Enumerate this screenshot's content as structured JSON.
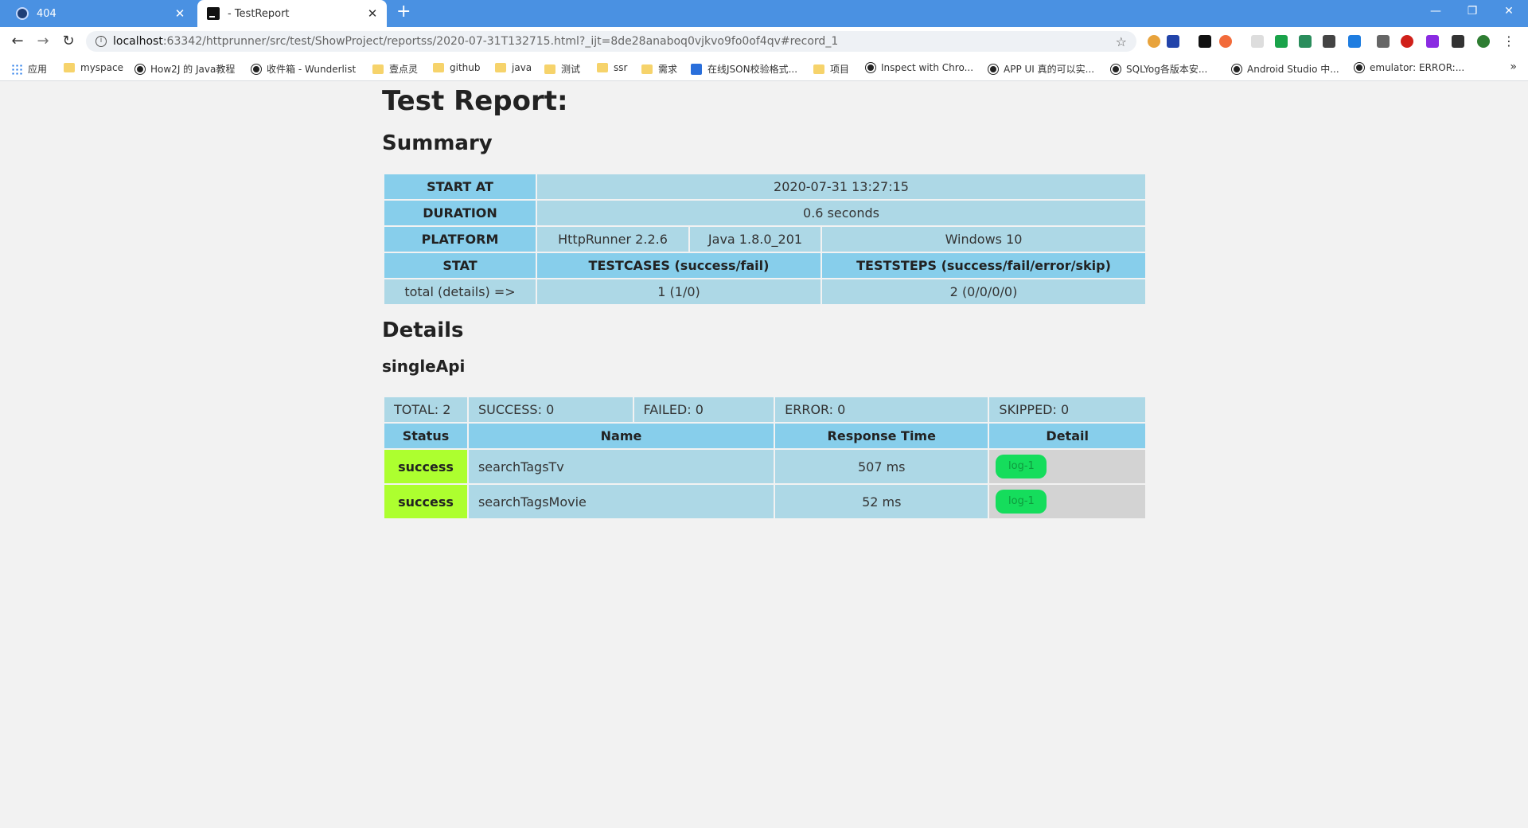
{
  "browser": {
    "tabs": [
      {
        "title": "404"
      },
      {
        "title": "- TestReport"
      }
    ],
    "new_tab": "+",
    "url_host": "localhost",
    "url_rest": ":63342/httprunner/src/test/ShowProject/reportss/2020-07-31T132715.html?_ijt=8de28anaboq0vjkvo9fo0of4qv#record_1",
    "bookmarks": [
      {
        "label": "应用",
        "icon": "apps-icon"
      },
      {
        "label": "myspace",
        "icon": "folder-icon"
      },
      {
        "label": "How2J 的 Java教程",
        "icon": "site-icon"
      },
      {
        "label": "收件箱 - Wunderlist",
        "icon": "site-icon"
      },
      {
        "label": "壹点灵",
        "icon": "folder-icon"
      },
      {
        "label": "github",
        "icon": "folder-icon"
      },
      {
        "label": "java",
        "icon": "folder-icon"
      },
      {
        "label": "测试",
        "icon": "folder-icon"
      },
      {
        "label": "ssr",
        "icon": "folder-icon"
      },
      {
        "label": "需求",
        "icon": "folder-icon"
      },
      {
        "label": "在线JSON校验格式...",
        "icon": "json-icon"
      },
      {
        "label": "项目",
        "icon": "folder-icon"
      },
      {
        "label": "Inspect with Chro...",
        "icon": "site-icon"
      },
      {
        "label": "APP UI 真的可以实...",
        "icon": "site-icon"
      },
      {
        "label": "SQLYog各版本安...",
        "icon": "site-icon"
      },
      {
        "label": "Android Studio 中...",
        "icon": "site-icon"
      },
      {
        "label": "emulator: ERROR:...",
        "icon": "site-icon"
      }
    ],
    "bookmarks_more": "»"
  },
  "report": {
    "title": "Test Report:",
    "summary_heading": "Summary",
    "summary": {
      "start_at_label": "START AT",
      "start_at": "2020-07-31 13:27:15",
      "duration_label": "DURATION",
      "duration": "0.6 seconds",
      "platform_label": "PLATFORM",
      "platform_httprunner": "HttpRunner 2.2.6",
      "platform_java": "Java 1.8.0_201",
      "platform_os": "Windows 10",
      "stat_label": "STAT",
      "testcases_label": "TESTCASES (success/fail)",
      "teststeps_label": "TESTSTEPS (success/fail/error/skip)",
      "total_label": "total (details) =>",
      "testcases_value": "1 (1/0)",
      "teststeps_value": "2 (0/0/0/0)"
    },
    "details_heading": "Details",
    "suite_name": "singleApi",
    "suite_summary": {
      "total": "TOTAL: 2",
      "success": "SUCCESS: 0",
      "failed": "FAILED: 0",
      "error": "ERROR: 0",
      "skipped": "SKIPPED: 0"
    },
    "columns": {
      "status": "Status",
      "name": "Name",
      "response_time": "Response Time",
      "detail": "Detail"
    },
    "records": [
      {
        "status": "success",
        "name": "searchTagsTv",
        "response_time": "507 ms",
        "log_label": "log-1"
      },
      {
        "status": "success",
        "name": "searchTagsMovie",
        "response_time": "52 ms",
        "log_label": "log-1"
      }
    ]
  },
  "colors": {
    "header_bg": "#87ceeb",
    "cell_bg": "#add8e6",
    "success_bg": "#adff2f",
    "log_button": "#15dd5c",
    "tabbar": "#4a91e2"
  }
}
